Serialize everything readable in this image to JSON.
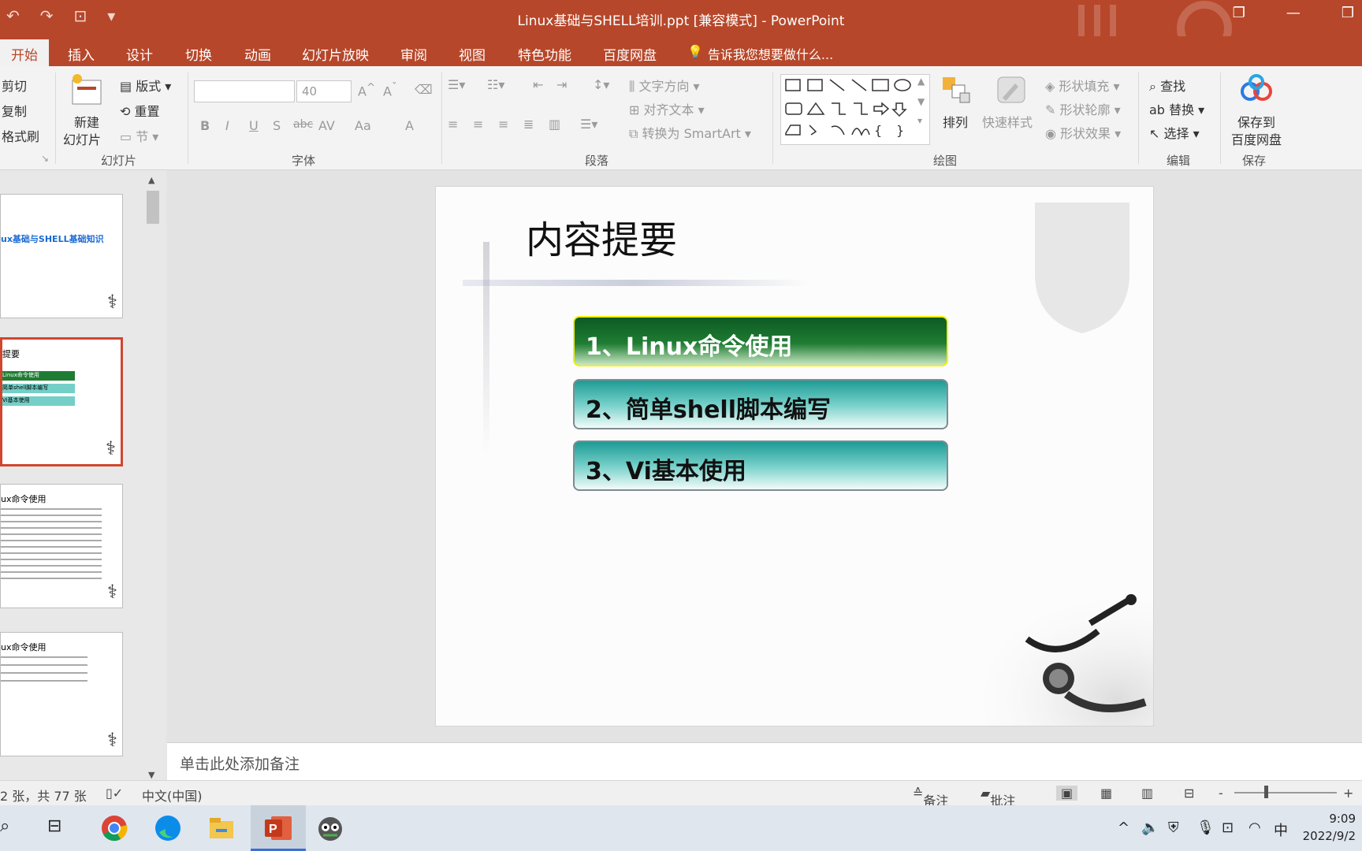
{
  "window": {
    "title": "Linux基础与SHELL培训.ppt [兼容模式] - PowerPoint",
    "qat": [
      "↶",
      "↷",
      "⊡",
      "▾"
    ],
    "controls": [
      "❐",
      "—",
      "❒"
    ]
  },
  "tabs": [
    {
      "label": "开始",
      "active": true
    },
    {
      "label": "插入"
    },
    {
      "label": "设计"
    },
    {
      "label": "切换"
    },
    {
      "label": "动画"
    },
    {
      "label": "幻灯片放映"
    },
    {
      "label": "审阅"
    },
    {
      "label": "视图"
    },
    {
      "label": "特色功能"
    },
    {
      "label": "百度网盘"
    }
  ],
  "tell_me": "告诉我您想要做什么...",
  "ribbon": {
    "clipboard": {
      "cut": "剪切",
      "copy": "复制",
      "format_painter": "格式刷"
    },
    "slides": {
      "new_slide_line1": "新建",
      "new_slide_line2": "幻灯片",
      "layout": "版式",
      "reset": "重置",
      "section": "节",
      "label": "幻灯片"
    },
    "font": {
      "size": "40",
      "bold": "B",
      "italic": "I",
      "underline": "U",
      "shadow": "S",
      "strike": "abc",
      "spacing": "AV",
      "case": "Aa",
      "color": "A",
      "label": "字体"
    },
    "paragraph": {
      "text_direction": "文字方向",
      "align_text": "对齐文本",
      "smartart": "转换为 SmartArt",
      "label": "段落"
    },
    "drawing": {
      "arrange": "排列",
      "quick_styles": "快速样式",
      "shape_fill": "形状填充",
      "shape_outline": "形状轮廓",
      "shape_effects": "形状效果",
      "label": "绘图"
    },
    "editing": {
      "find": "查找",
      "replace": "替换",
      "select": "选择",
      "label": "编辑"
    },
    "save": {
      "line1": "保存到",
      "line2": "百度网盘",
      "label": "保存"
    }
  },
  "thumbnails": [
    {
      "text": "ux基础与SHELL基础知识"
    },
    {
      "text": "提要",
      "items": [
        "Linux命令使用",
        "简单shell脚本编写",
        "Vi基本使用"
      ]
    },
    {
      "text": "ux命令使用"
    },
    {
      "text": "ux命令使用"
    }
  ],
  "slide": {
    "title": "内容提要",
    "items": [
      "1、Linux命令使用",
      "2、简单shell脚本编写",
      "3、Vi基本使用"
    ]
  },
  "notes_placeholder": "单击此处添加备注",
  "status": {
    "slide_count": "2 张，共 77 张",
    "language": "中文(中国)",
    "notes": "备注",
    "comments": "批注",
    "zoom_minus": "-",
    "zoom_plus": "+"
  },
  "taskbar": {
    "ime": "中",
    "time": "9:09",
    "date": "2022/9/2"
  },
  "colors": {
    "accent": "#b7472a",
    "item1": "#1f7d33",
    "item_teal": "#4fb7b0"
  }
}
